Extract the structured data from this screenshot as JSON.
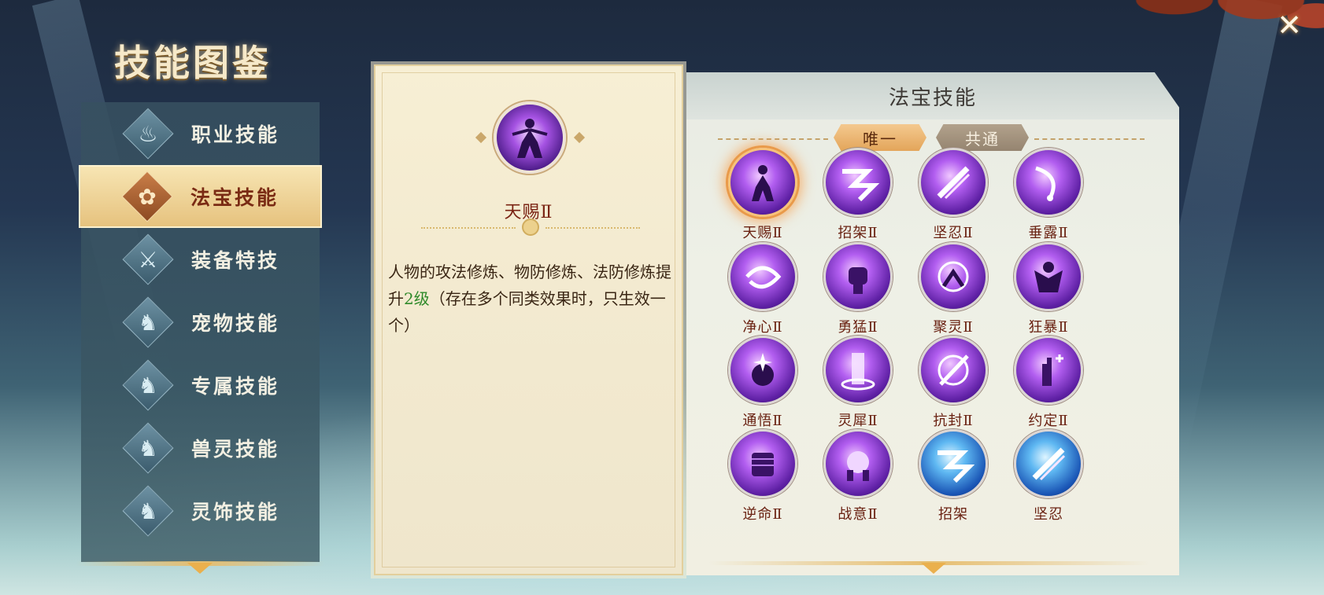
{
  "page": {
    "title": "技能图鉴"
  },
  "close": {
    "icon": "close-icon",
    "glyph": "✕"
  },
  "sidebar": {
    "items": [
      {
        "label": "职业技能",
        "icon": "book-flame-icon",
        "glyph": "♨",
        "active": false
      },
      {
        "label": "法宝技能",
        "icon": "treasure-icon",
        "glyph": "✿",
        "active": true
      },
      {
        "label": "装备特技",
        "icon": "equipment-icon",
        "glyph": "⚔",
        "active": false
      },
      {
        "label": "宠物技能",
        "icon": "cat-pet-icon",
        "glyph": "♞",
        "active": false
      },
      {
        "label": "专属技能",
        "icon": "cat-pet-icon",
        "glyph": "♞",
        "active": false
      },
      {
        "label": "兽灵技能",
        "icon": "cat-pet-icon",
        "glyph": "♞",
        "active": false
      },
      {
        "label": "灵饰技能",
        "icon": "cat-pet-icon",
        "glyph": "♞",
        "active": false
      }
    ]
  },
  "detail": {
    "name": "天赐Ⅱ",
    "icon": "figure-radiance-icon",
    "desc_before": "人物的攻法修炼、物防修炼、法防修炼提升",
    "desc_highlight": "2级",
    "desc_after": "（存在多个同类效果时，只生效一个）",
    "highlight_color": "#2f8a2a"
  },
  "skills_panel": {
    "title": "法宝技能",
    "tabs": [
      {
        "label": "唯一",
        "active": true
      },
      {
        "label": "共通",
        "active": false
      }
    ],
    "skills": [
      {
        "name": "天赐Ⅱ",
        "icon": "figure-radiance-icon",
        "color": "purple",
        "selected": true
      },
      {
        "name": "招架Ⅱ",
        "icon": "zigzag-arrow-icon",
        "color": "purple",
        "selected": false
      },
      {
        "name": "坚忍Ⅱ",
        "icon": "slash-burst-icon",
        "color": "purple",
        "selected": false
      },
      {
        "name": "垂露Ⅱ",
        "icon": "dewdrop-icon",
        "color": "purple",
        "selected": false
      },
      {
        "name": "净心Ⅱ",
        "icon": "swirl-icon",
        "color": "purple",
        "selected": false
      },
      {
        "name": "勇猛Ⅱ",
        "icon": "fist-icon",
        "color": "purple",
        "selected": false
      },
      {
        "name": "聚灵Ⅱ",
        "icon": "vortex-figure-icon",
        "color": "purple",
        "selected": false
      },
      {
        "name": "狂暴Ⅱ",
        "icon": "rage-figure-icon",
        "color": "purple",
        "selected": false
      },
      {
        "name": "通悟Ⅱ",
        "icon": "star-mind-icon",
        "color": "purple",
        "selected": false
      },
      {
        "name": "灵犀Ⅱ",
        "icon": "light-pillar-icon",
        "color": "purple",
        "selected": false
      },
      {
        "name": "抗封Ⅱ",
        "icon": "ring-slash-icon",
        "color": "purple",
        "selected": false
      },
      {
        "name": "约定Ⅱ",
        "icon": "hand-cross-icon",
        "color": "purple",
        "selected": false
      },
      {
        "name": "逆命Ⅱ",
        "icon": "grip-hand-icon",
        "color": "purple",
        "selected": false
      },
      {
        "name": "战意Ⅱ",
        "icon": "orb-grip-icon",
        "color": "purple",
        "selected": false
      },
      {
        "name": "招架",
        "icon": "zigzag-arrow-icon",
        "color": "blue",
        "selected": false
      },
      {
        "name": "坚忍",
        "icon": "slash-burst-icon",
        "color": "blue",
        "selected": false
      }
    ]
  }
}
